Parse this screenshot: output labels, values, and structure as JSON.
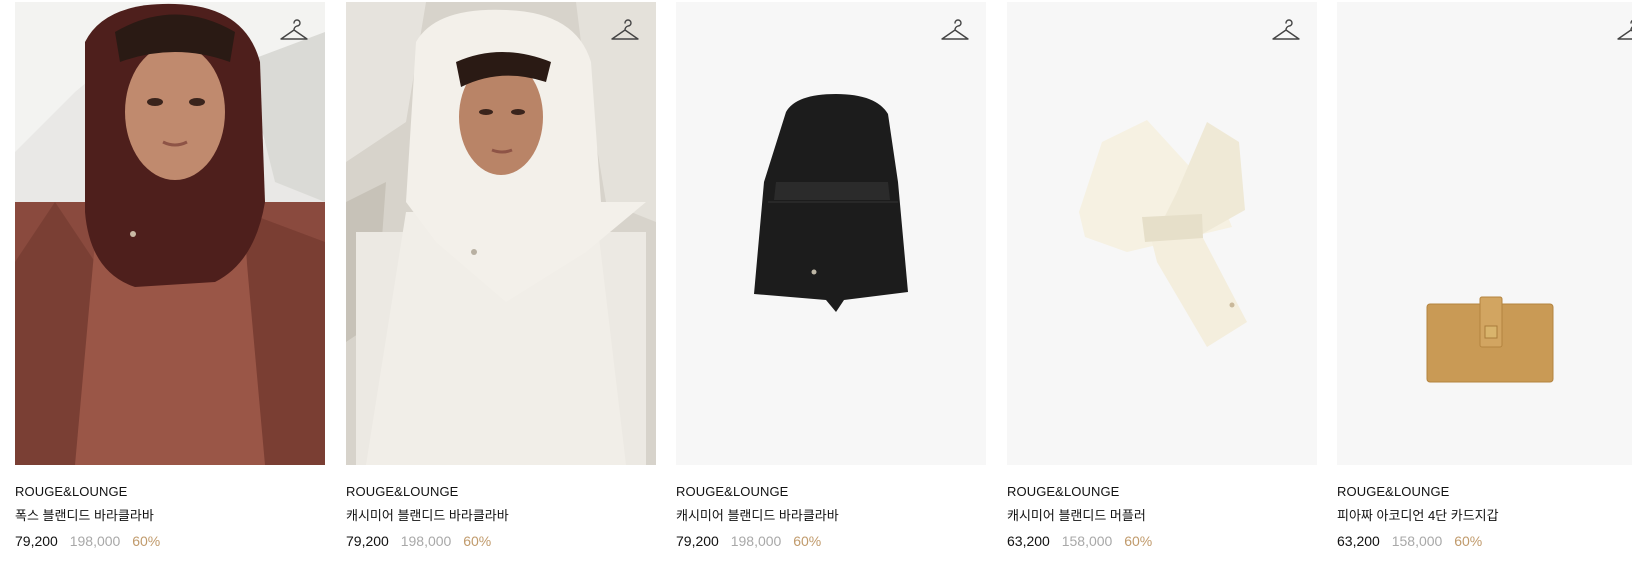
{
  "colors": {
    "discount": "#c09a6b",
    "original_price": "#a8a8a8",
    "text": "#111111"
  },
  "products": [
    {
      "brand": "ROUGE&LOUNGE",
      "name": "폭스 블랜디드 바라클라바",
      "sale_price": "79,200",
      "original_price": "198,000",
      "discount": "60%",
      "image": "model-brown-balaclava",
      "wishlist_icon": "hanger-icon"
    },
    {
      "brand": "ROUGE&LOUNGE",
      "name": "캐시미어 블랜디드 바라클라바",
      "sale_price": "79,200",
      "original_price": "198,000",
      "discount": "60%",
      "image": "model-ivory-balaclava",
      "wishlist_icon": "hanger-icon"
    },
    {
      "brand": "ROUGE&LOUNGE",
      "name": "캐시미어 블랜디드 바라클라바",
      "sale_price": "79,200",
      "original_price": "198,000",
      "discount": "60%",
      "image": "black-balaclava",
      "wishlist_icon": "hanger-icon"
    },
    {
      "brand": "ROUGE&LOUNGE",
      "name": "캐시미어 블랜디드 머플러",
      "sale_price": "63,200",
      "original_price": "158,000",
      "discount": "60%",
      "image": "ivory-muffler",
      "wishlist_icon": "hanger-icon"
    },
    {
      "brand": "ROUGE&LOUNGE",
      "name": "피아짜 아코디언 4단 카드지갑",
      "sale_price": "63,200",
      "original_price": "158,000",
      "discount": "60%",
      "image": "camel-card-wallet",
      "wishlist_icon": "hanger-icon"
    }
  ]
}
